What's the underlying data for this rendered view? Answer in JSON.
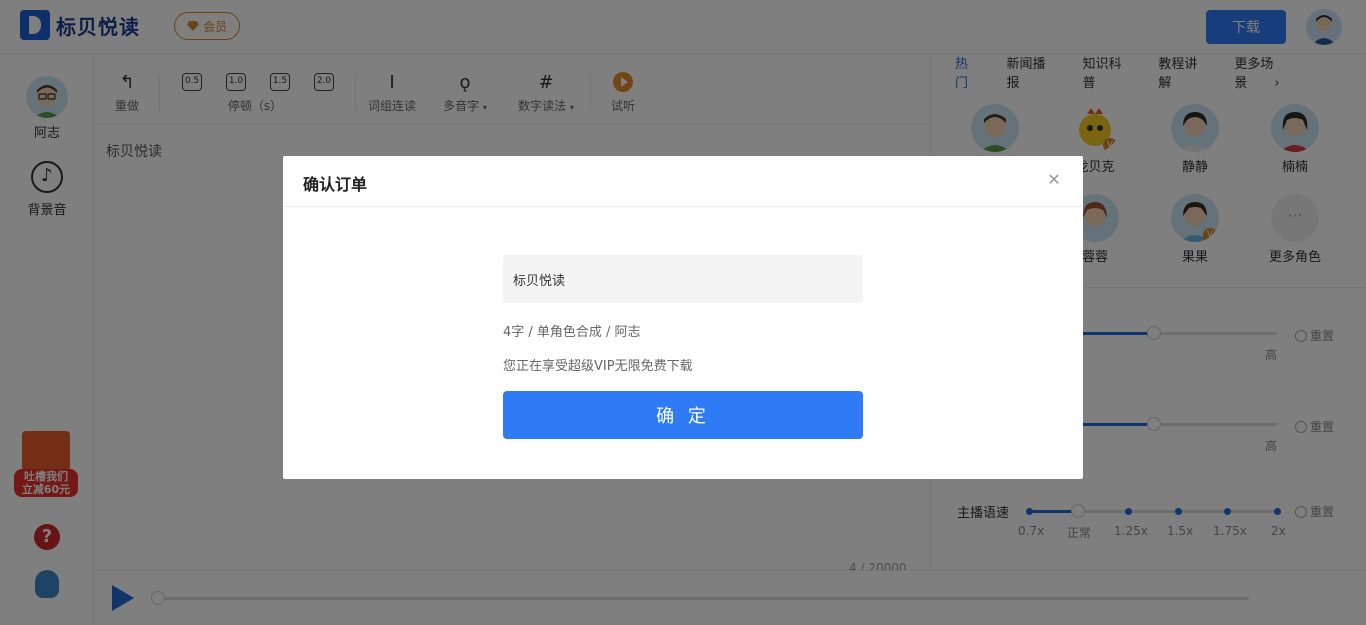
{
  "header": {
    "logo_text": "标贝悦读",
    "vip_label": "会员",
    "download_label": "下载"
  },
  "sidebar": {
    "voice_label": "阿志",
    "bgm_label": "背景音",
    "promo_line1": "吐槽我们",
    "promo_line2": "立减60元"
  },
  "toolbar": {
    "redo_label": "重做",
    "pause_values": [
      "0.5",
      "1.0",
      "1.5",
      "2.0"
    ],
    "pause_label": "停顿（s）",
    "word_group_label": "词组连读",
    "polyphone_label": "多音字",
    "number_label": "数字读法",
    "preview_label": "试听"
  },
  "editor": {
    "text": "标贝悦读",
    "counter": "4 / 20000"
  },
  "right_panel": {
    "tabs": [
      "热门",
      "新闻播报",
      "知识科普",
      "教程讲解",
      "更多场景"
    ],
    "roles": [
      "",
      "龙贝克",
      "静静",
      "楠楠",
      "",
      "蓉蓉",
      "果果",
      "更多角色"
    ],
    "reset_label": "重置",
    "high_label": "高",
    "speed_label": "主播语速",
    "speed_ticks": [
      "0.7x",
      "正常",
      "1.25x",
      "1.5x",
      "1.75x",
      "2x"
    ]
  },
  "modal": {
    "title": "确认订单",
    "text_preview": "标贝悦读",
    "meta": "4字 / 单角色合成 / 阿志",
    "vip_note": "您正在享受超级VIP无限免费下载",
    "confirm_label": "确 定"
  }
}
